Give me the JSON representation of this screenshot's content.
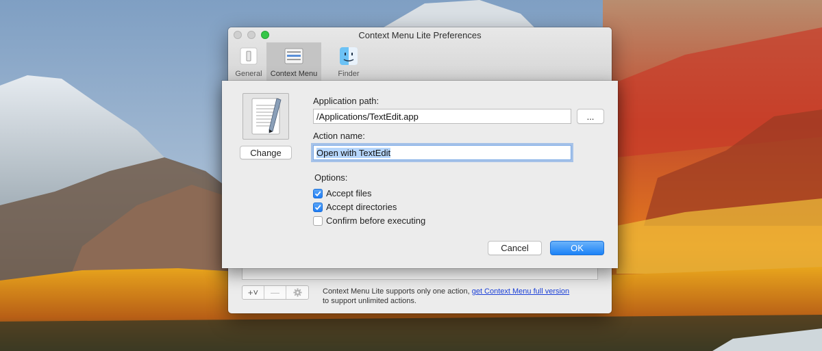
{
  "window": {
    "title": "Context Menu Lite Preferences",
    "toolbar": [
      {
        "label": "General",
        "icon": "switch-icon",
        "active": false
      },
      {
        "label": "Context Menu",
        "icon": "context-menu-list-icon",
        "active": true
      },
      {
        "label": "Finder",
        "icon": "finder-icon",
        "active": false
      }
    ],
    "segmented": {
      "add": "+˅",
      "remove": "—",
      "settings_icon": "gear-icon"
    },
    "note": {
      "text_before": "Context Menu Lite supports only one action,",
      "link": "get Context Menu full version",
      "text_after": "to support unlimited actions."
    }
  },
  "sheet": {
    "app_icon": "textedit-icon",
    "change_label": "Change",
    "application_path_label": "Application path:",
    "application_path_value": "/Applications/TextEdit.app",
    "browse_label": "...",
    "action_name_label": "Action name:",
    "action_name_value": "Open with TextEdit",
    "options_label": "Options:",
    "options": [
      {
        "label": "Accept files",
        "checked": true
      },
      {
        "label": "Accept directories",
        "checked": true
      },
      {
        "label": "Confirm before executing",
        "checked": false
      }
    ],
    "cancel_label": "Cancel",
    "ok_label": "OK"
  },
  "colors": {
    "accent": "#1b82f7",
    "link": "#1a3fd8",
    "zoom_light": "#35c648"
  }
}
